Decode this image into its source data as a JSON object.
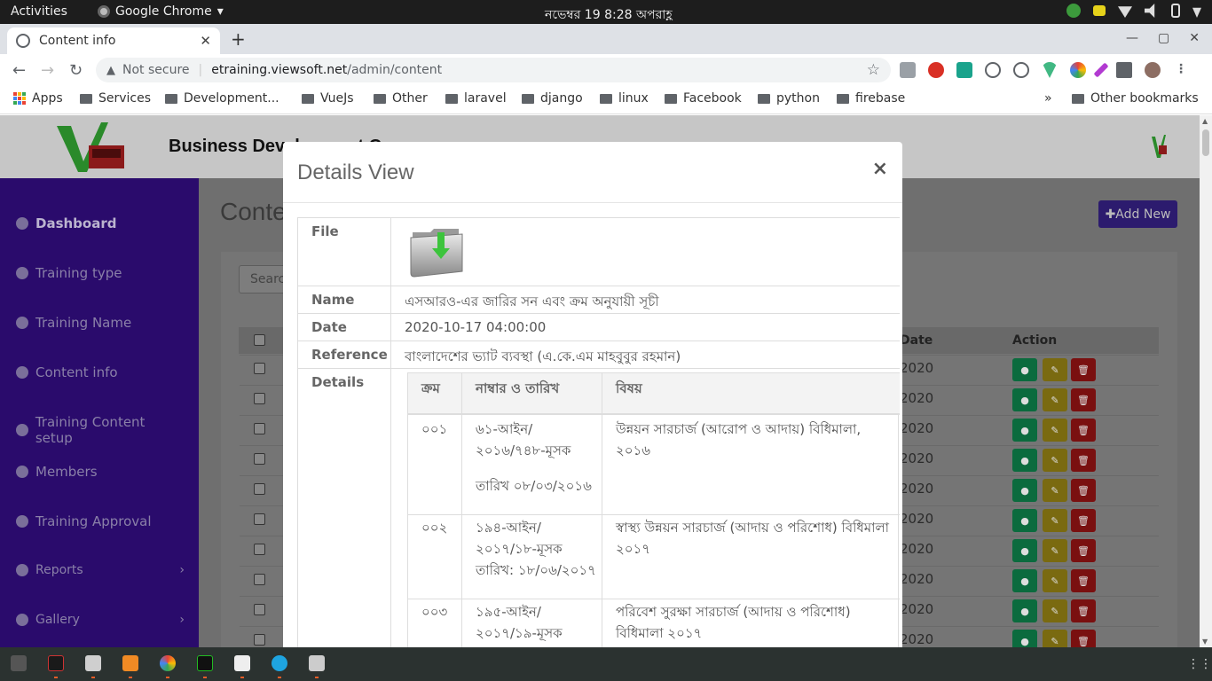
{
  "system": {
    "activities": "Activities",
    "app_name": "Google Chrome",
    "app_arrow": "▾",
    "clock": "নভেম্বর 19   8:28 অপরাহ্ণ"
  },
  "browser": {
    "tab_title": "Content info",
    "tab_close": "✕",
    "new_tab": "+",
    "win_min": "—",
    "win_max": "▢",
    "win_close": "✕",
    "back": "←",
    "forward": "→",
    "reload": "↻",
    "security_icon": "▲",
    "security_label": "Not secure",
    "url_host": "etraining.viewsoft.net",
    "url_path": "/admin/content",
    "star": "☆",
    "bookmarks": [
      {
        "label": "Apps"
      },
      {
        "label": "Services"
      },
      {
        "label": "Development..."
      },
      {
        "label": "VueJs"
      },
      {
        "label": "Other"
      },
      {
        "label": "laravel"
      },
      {
        "label": "django"
      },
      {
        "label": "linux"
      },
      {
        "label": "Facebook"
      },
      {
        "label": "python"
      },
      {
        "label": "firebase"
      }
    ],
    "bookmarks_more": "»",
    "other_bookmarks": "Other bookmarks"
  },
  "page": {
    "brand": "Business Development C",
    "title": "Conte",
    "add_new": "✚Add New",
    "search_placeholder": "Searc",
    "sidebar": [
      {
        "label": "Dashboard"
      },
      {
        "label": "Training type"
      },
      {
        "label": "Training Name"
      },
      {
        "label": "Content info"
      },
      {
        "label": "Training Content setup"
      },
      {
        "label": "Members"
      },
      {
        "label": "Training Approval"
      },
      {
        "label": "Reports"
      },
      {
        "label": "Gallery"
      }
    ],
    "sidebar_chevron": "›",
    "table": {
      "date_header": "Date",
      "action_header": "Action",
      "row_dates": [
        "2020",
        "2020",
        "2020",
        "2020",
        "2020",
        "2020",
        "2020",
        "2020",
        "2020",
        "2020"
      ],
      "view_icon": "●",
      "edit_icon": "✎",
      "delete_icon": "🗑"
    }
  },
  "modal": {
    "title": "Details View",
    "close": "×",
    "labels": {
      "file": "File",
      "name": "Name",
      "date": "Date",
      "reference": "Reference",
      "details": "Details"
    },
    "name": "এসআরও-এর জারির সন এবং ক্রম অনুযায়ী সূচী",
    "date": "2020-10-17 04:00:00",
    "reference": "বাংলাদেশের ভ্যাট ব্যবস্থা (এ.কে.এম মাহবুবুর রহমান)",
    "details_table": {
      "headers": [
        "ক্রম",
        "নাম্বার ও তারিখ",
        "বিষয়"
      ],
      "rows": [
        {
          "serial": "০০১",
          "number_l1": "৬১-আইন/",
          "number_l2": "২০১৬/৭৪৮-মূসক",
          "number_l3": "তারিখ ০৮/০৩/২০১৬",
          "subject_l1": "উন্নয়ন সারচার্জ (আরোপ ও আদায়) বিধিমালা, ২০১৬",
          "subject_l2": ""
        },
        {
          "serial": "০০২",
          "number_l1": "১৯৪-আইন/",
          "number_l2": "২০১৭/১৮-মূসক",
          "number_l3": "তারিখ: ১৮/০৬/২০১৭",
          "subject_l1": "স্বাস্থ্য উন্নয়ন সারচার্জ (আদায় ও পরিশোধ) বিধিমালা",
          "subject_l2": "২০১৭"
        },
        {
          "serial": "০০৩",
          "number_l1": "১৯৫-আইন/",
          "number_l2": "২০১৭/১৯-মূসক",
          "number_l3": "",
          "subject_l1": "পরিবেশ সুরক্ষা সারচার্জ (আদায় ও পরিশোধ)",
          "subject_l2": "বিধিমালা ২০১৭"
        }
      ]
    }
  },
  "colors": {
    "sidebar": "#2a0b6c",
    "modal_bg": "#ffffff",
    "view_btn": "#0b6b3e",
    "edit_btn": "#7a6a10",
    "delete_btn": "#7a1010"
  }
}
